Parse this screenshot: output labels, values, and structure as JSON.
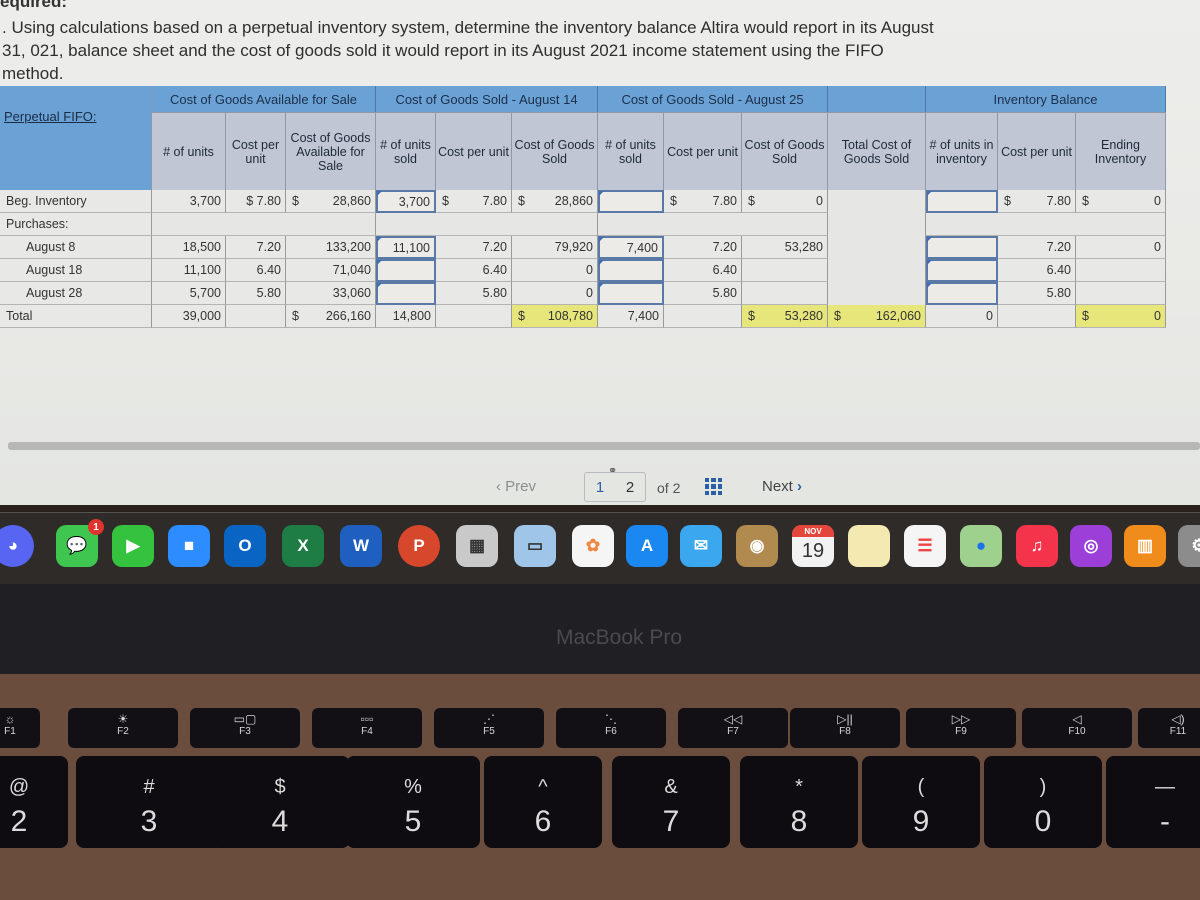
{
  "instructions": {
    "heading": "equired:",
    "text": ". Using calculations based on a perpetual inventory system, determine the inventory balance Altira would report in its August 31, 021, balance sheet and the cost of goods sold it would report in its August 2021 income statement using the FIFO method."
  },
  "table": {
    "title": "Perpetual FIFO:",
    "groups": {
      "available": "Cost of Goods Available for Sale",
      "aug14": "Cost of Goods Sold - August 14",
      "aug25": "Cost of Goods Sold - August 25",
      "balance": "Inventory Balance"
    },
    "headers": {
      "avail_units": "# of units",
      "avail_cost": "Cost per unit",
      "avail_total": "Cost of Goods Available for Sale",
      "a14_units": "# of units sold",
      "a14_cost": "Cost per unit",
      "a14_cogs": "Cost of Goods Sold",
      "a25_units": "# of units sold",
      "a25_cost": "Cost per unit",
      "a25_cogs": "Cost of Goods Sold",
      "total_cogs": "Total Cost of Goods Sold",
      "bal_units": "# of units in inventory",
      "bal_cost": "Cost per unit",
      "bal_ending": "Ending Inventory"
    },
    "currency": "$",
    "rows": {
      "beg": {
        "label": "Beg. Inventory",
        "avail_units": "3,700",
        "avail_cost": "$ 7.80",
        "avail_total": "28,860",
        "a14_units": "3,700",
        "a14_cost": "7.80",
        "a14_cogs": "28,860",
        "a25_units": "",
        "a25_cost": "7.80",
        "a25_cogs": "0",
        "bal_units": "",
        "bal_cost": "7.80",
        "bal_ending": "0"
      },
      "purchases": {
        "label": "Purchases:"
      },
      "aug8": {
        "label": "August 8",
        "avail_units": "18,500",
        "avail_cost": "7.20",
        "avail_total": "133,200",
        "a14_units": "11,100",
        "a14_cost": "7.20",
        "a14_cogs": "79,920",
        "a25_units": "7,400",
        "a25_cost": "7.20",
        "a25_cogs": "53,280",
        "bal_units": "",
        "bal_cost": "7.20",
        "bal_ending": "0"
      },
      "aug18": {
        "label": "August 18",
        "avail_units": "11,100",
        "avail_cost": "6.40",
        "avail_total": "71,040",
        "a14_units": "",
        "a14_cost": "6.40",
        "a14_cogs": "0",
        "a25_units": "",
        "a25_cost": "6.40",
        "a25_cogs": "",
        "bal_units": "",
        "bal_cost": "6.40",
        "bal_ending": ""
      },
      "aug28": {
        "label": "August 28",
        "avail_units": "5,700",
        "avail_cost": "5.80",
        "avail_total": "33,060",
        "a14_units": "",
        "a14_cost": "5.80",
        "a14_cogs": "0",
        "a25_units": "",
        "a25_cost": "5.80",
        "a25_cogs": "",
        "bal_units": "",
        "bal_cost": "5.80",
        "bal_ending": ""
      },
      "total": {
        "label": "Total",
        "avail_units": "39,000",
        "avail_total": "266,160",
        "a14_units": "14,800",
        "a14_cogs": "108,780",
        "a25_units": "7,400",
        "a25_cogs": "53,280",
        "total_cogs": "162,060",
        "bal_units": "0",
        "bal_ending": "0"
      }
    },
    "colors": {
      "group_header": "#6aa2d6",
      "sub_header": "#c0c6d3",
      "highlight": "#e6e67a",
      "input_border": "#5a79a6"
    }
  },
  "pager": {
    "prev": "Prev",
    "page1": "1",
    "page2": "2",
    "of": "of 2",
    "next": "Next"
  },
  "dock": {
    "apps": [
      "Discord",
      "Messages",
      "FaceTime",
      "Zoom",
      "Outlook",
      "Excel",
      "Word",
      "PowerPoint",
      "Calculator",
      "Preview",
      "Photos",
      "App Store",
      "Mail",
      "Contacts",
      "Calendar",
      "Notes",
      "Reminders",
      "Maps",
      "Music",
      "Podcasts",
      "Books",
      "System Preferences"
    ],
    "messages_badge": "1",
    "calendar_month": "NOV",
    "calendar_day": "19",
    "letters": {
      "outlook": "O",
      "excel": "X",
      "word": "W",
      "powerpoint": "P"
    }
  },
  "laptop": {
    "brand": "MacBook Pro"
  },
  "keyboard": {
    "fkeys": [
      "F1",
      "F2",
      "F3",
      "F4",
      "F5",
      "F6",
      "F7",
      "F8",
      "F9",
      "F10",
      "F11"
    ],
    "numkeys": [
      {
        "top": "@",
        "num": "2"
      },
      {
        "top": "#",
        "num": "3"
      },
      {
        "top": "$",
        "num": "4"
      },
      {
        "top": "%",
        "num": "5"
      },
      {
        "top": "^",
        "num": "6"
      },
      {
        "top": "&",
        "num": "7"
      },
      {
        "top": "*",
        "num": "8"
      },
      {
        "top": "(",
        "num": "9"
      },
      {
        "top": ")",
        "num": "0"
      },
      {
        "top": "—",
        "num": "-"
      }
    ]
  }
}
